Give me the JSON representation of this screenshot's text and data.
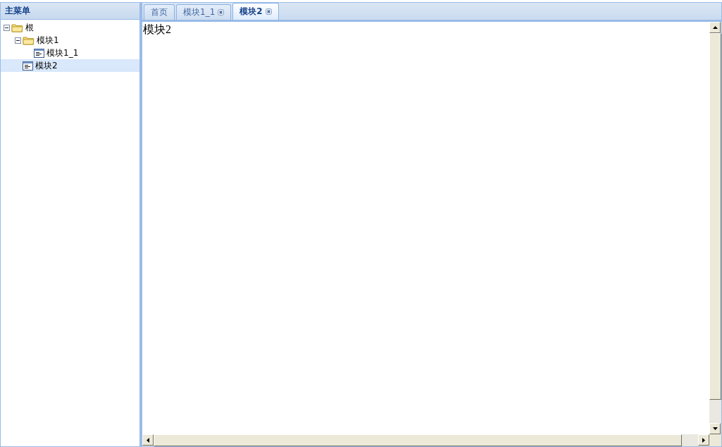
{
  "sidebar": {
    "title": "主菜单",
    "tree": [
      {
        "label": "根",
        "kind": "folder",
        "expanded": true,
        "selected": false,
        "children": [
          {
            "label": "模块1",
            "kind": "folder",
            "expanded": true,
            "selected": false,
            "children": [
              {
                "label": "模块1_1",
                "kind": "page",
                "selected": false
              }
            ]
          },
          {
            "label": "模块2",
            "kind": "page",
            "selected": true
          }
        ]
      }
    ]
  },
  "tabs": [
    {
      "label": "首页",
      "selected": false,
      "closable": false
    },
    {
      "label": "模块1_1",
      "selected": false,
      "closable": true
    },
    {
      "label": "模块2",
      "selected": true,
      "closable": true
    }
  ],
  "content": {
    "text": "模块2"
  }
}
